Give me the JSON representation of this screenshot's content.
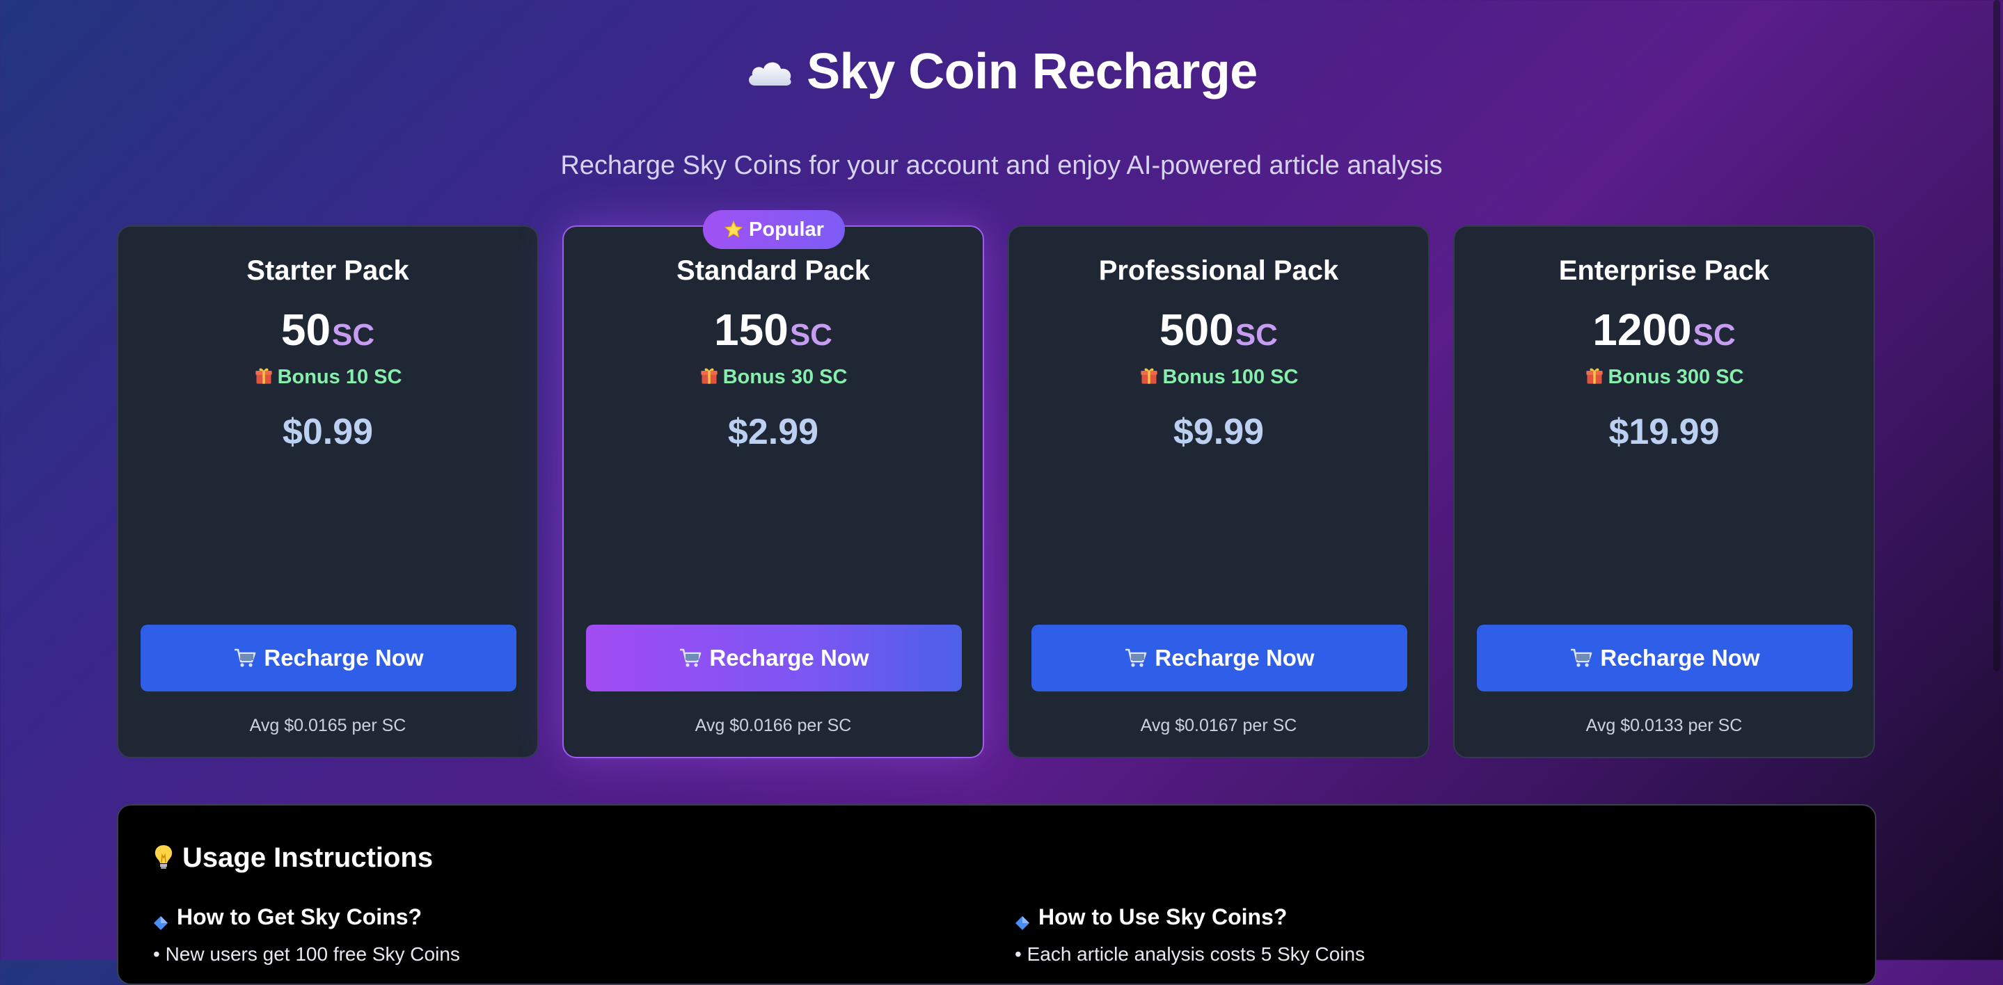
{
  "header": {
    "title": "Sky Coin Recharge",
    "title_icon": "cloud-icon",
    "subtitle": "Recharge Sky Coins for your account and enjoy AI-powered article analysis"
  },
  "popular_badge": {
    "label": "Popular",
    "icon": "star-icon"
  },
  "plans": [
    {
      "name": "Starter Pack",
      "amount": "50",
      "unit": "SC",
      "bonus": "Bonus 10 SC",
      "price": "$0.99",
      "button": "Recharge Now",
      "avg": "Avg $0.0165 per SC",
      "popular": false
    },
    {
      "name": "Standard Pack",
      "amount": "150",
      "unit": "SC",
      "bonus": "Bonus 30 SC",
      "price": "$2.99",
      "button": "Recharge Now",
      "avg": "Avg $0.0166 per SC",
      "popular": true
    },
    {
      "name": "Professional Pack",
      "amount": "500",
      "unit": "SC",
      "bonus": "Bonus 100 SC",
      "price": "$9.99",
      "button": "Recharge Now",
      "avg": "Avg $0.0167 per SC",
      "popular": false
    },
    {
      "name": "Enterprise Pack",
      "amount": "1200",
      "unit": "SC",
      "bonus": "Bonus 300 SC",
      "price": "$19.99",
      "button": "Recharge Now",
      "avg": "Avg $0.0133 per SC",
      "popular": false
    }
  ],
  "usage": {
    "title": "Usage Instructions",
    "title_icon": "lightbulb-icon",
    "left": {
      "heading": "How to Get Sky Coins?",
      "first_item": "• New users get 100 free Sky Coins"
    },
    "right": {
      "heading": "How to Use Sky Coins?",
      "first_item": "• Each article analysis costs 5 Sky Coins"
    }
  },
  "colors": {
    "accent_blue": "#2f5fe9",
    "accent_purple": "#a24cf3",
    "bonus_green": "#86efac",
    "price_blue": "#bcd0f2",
    "card_bg": "#1f2735"
  }
}
